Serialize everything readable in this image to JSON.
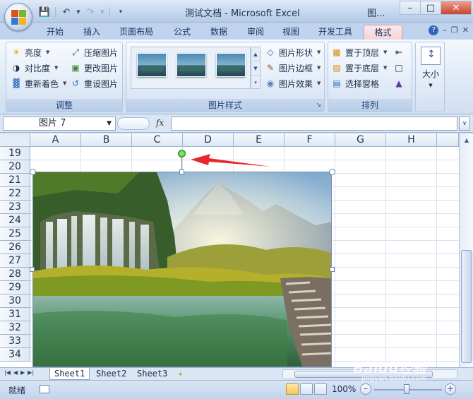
{
  "window": {
    "title": "测试文档 - Microsoft Excel",
    "title_extra": "图..."
  },
  "tabs": [
    "开始",
    "插入",
    "页面布局",
    "公式",
    "数据",
    "审阅",
    "视图",
    "开发工具",
    "格式"
  ],
  "active_tab": "格式",
  "ribbon": {
    "adjust": {
      "label": "调整",
      "brightness": "亮度",
      "contrast": "对比度",
      "recolor": "重新着色",
      "compress": "压缩图片",
      "change": "更改图片",
      "reset": "重设图片"
    },
    "styles": {
      "label": "图片样式",
      "shape": "图片形状",
      "border": "图片边框",
      "effects": "图片效果"
    },
    "arrange": {
      "label": "排列",
      "front": "置于顶层",
      "back": "置于底层",
      "pane": "选择窗格"
    },
    "size": {
      "label": "大小"
    }
  },
  "formula_bar": {
    "name_box": "图片 7",
    "fx": "fx",
    "value": ""
  },
  "columns": [
    "A",
    "B",
    "C",
    "D",
    "E",
    "F",
    "G",
    "H"
  ],
  "rows": [
    "19",
    "20",
    "21",
    "22",
    "23",
    "24",
    "25",
    "26",
    "27",
    "28",
    "29",
    "30",
    "31",
    "32",
    "33",
    "34"
  ],
  "sheets": [
    "Sheet1",
    "Sheet2",
    "Sheet3"
  ],
  "active_sheet": "Sheet1",
  "status": {
    "ready": "就绪",
    "zoom": "100%"
  },
  "watermark": {
    "line1": "Baidu经验",
    "line2": "jingyan.baidu.com"
  },
  "colors": {
    "arrow": "#e8282b",
    "active_tab_bg": "#f2d5d8"
  }
}
